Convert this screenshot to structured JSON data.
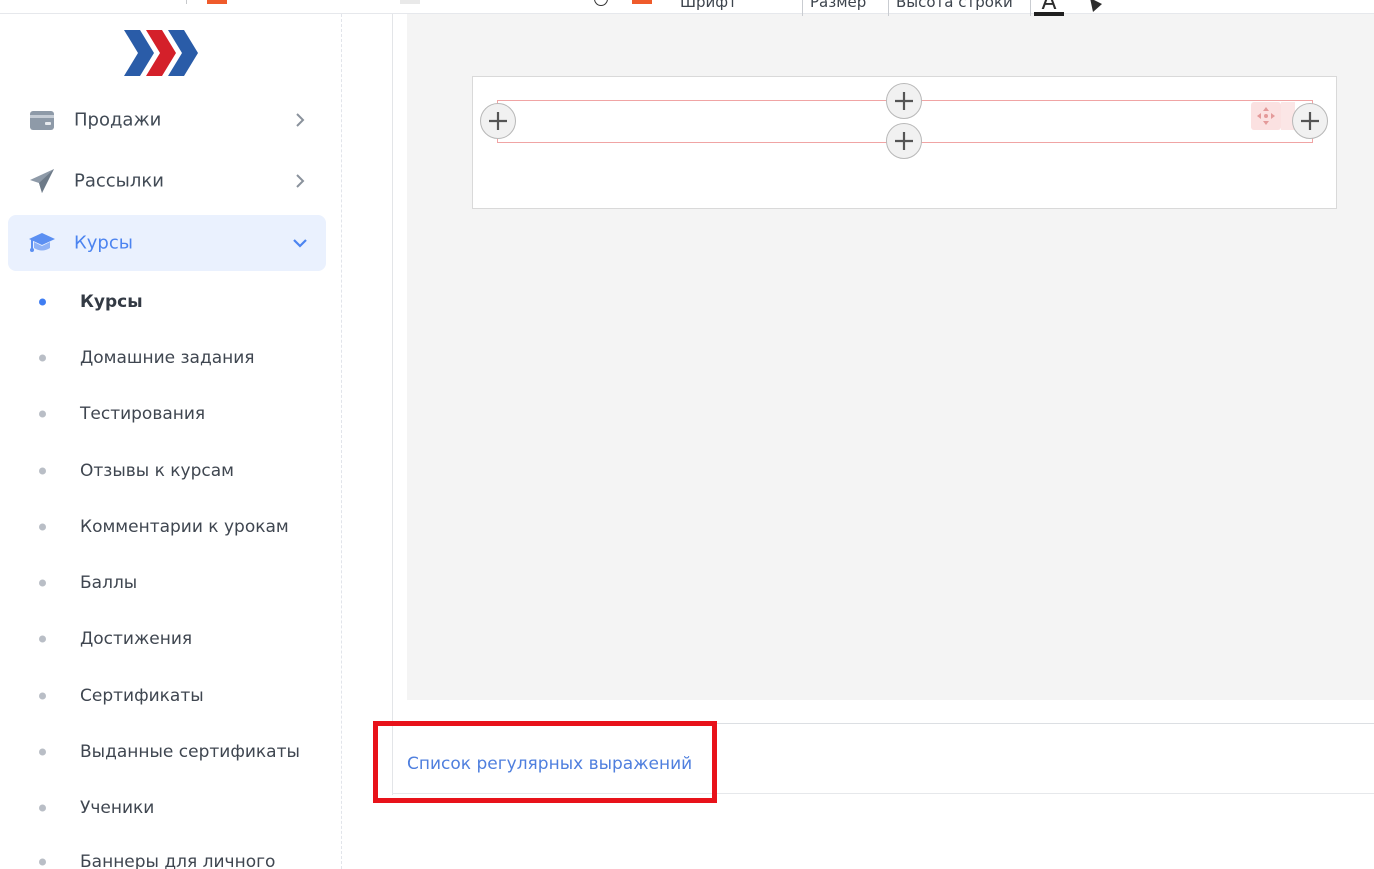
{
  "toolbar": {
    "font_label": "Шрифт",
    "size_label": "Размер",
    "line_height_label": "Высота строки",
    "text_color_glyph": "A"
  },
  "sidebar": {
    "items": [
      {
        "label": "Продажи",
        "icon": "wallet-card-icon",
        "expanded": false
      },
      {
        "label": "Рассылки",
        "icon": "paper-plane-icon",
        "expanded": false
      },
      {
        "label": "Курсы",
        "icon": "graduation-cap-icon",
        "expanded": true
      }
    ],
    "sub_items": [
      {
        "label": "Курсы",
        "current": true
      },
      {
        "label": "Домашние задания",
        "current": false
      },
      {
        "label": "Тестирования",
        "current": false
      },
      {
        "label": "Отзывы к курсам",
        "current": false
      },
      {
        "label": "Комментарии к урокам",
        "current": false
      },
      {
        "label": "Баллы",
        "current": false
      },
      {
        "label": "Достижения",
        "current": false
      },
      {
        "label": "Сертификаты",
        "current": false
      },
      {
        "label": "Выданные сертификаты",
        "current": false
      },
      {
        "label": "Ученики",
        "current": false
      },
      {
        "label": "Баннеры для личного",
        "current": false
      }
    ]
  },
  "footer": {
    "regex_link": "Список регулярных выражений"
  },
  "colors": {
    "accent": "#4c84f0",
    "active_bg": "#eaf1fe",
    "highlight": "#e8121a",
    "logo_blue": "#2a5ca8",
    "logo_red": "#d4202a"
  }
}
